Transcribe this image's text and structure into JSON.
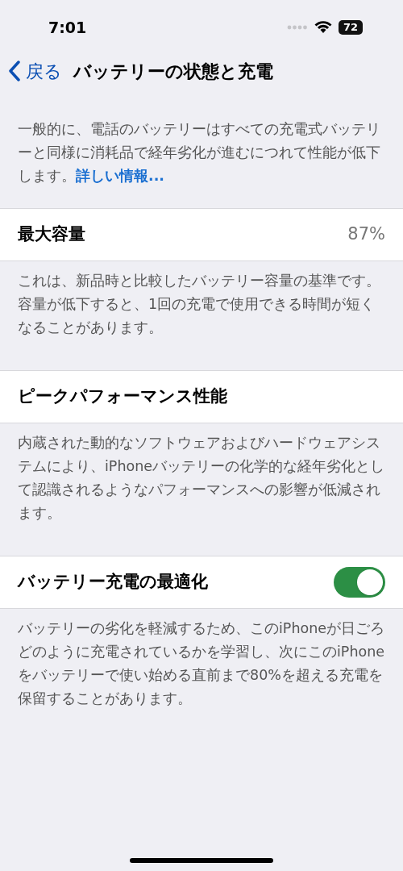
{
  "status_bar": {
    "time": "7:01",
    "battery": "72"
  },
  "nav": {
    "back": "戻る",
    "title": "バッテリーの状態と充電"
  },
  "intro": {
    "text": "一般的に、電話のバッテリーはすべての充電式バッテリーと同様に消耗品で経年劣化が進むにつれて性能が低下します。",
    "link": "詳しい情報..."
  },
  "sections": [
    {
      "kind": "value",
      "label": "最大容量",
      "value": "87%",
      "footer": "これは、新品時と比較したバッテリー容量の基準です。容量が低下すると、1回の充電で使用できる時間が短くなることがあります。"
    },
    {
      "kind": "plain",
      "label": "ピークパフォーマンス性能",
      "footer": "内蔵された動的なソフトウェアおよびハードウェアシステムにより、iPhoneバッテリーの化学的な経年劣化として認識されるようなパフォーマンスへの影響が低減されます。"
    },
    {
      "kind": "toggle",
      "label": "バッテリー充電の最適化",
      "on": true,
      "footer": "バッテリーの劣化を軽減するため、このiPhoneが日ごろどのように充電されているかを学習し、次にこのiPhoneをバッテリーで使い始める直前まで80%を超える充電を保留することがあります。"
    }
  ]
}
